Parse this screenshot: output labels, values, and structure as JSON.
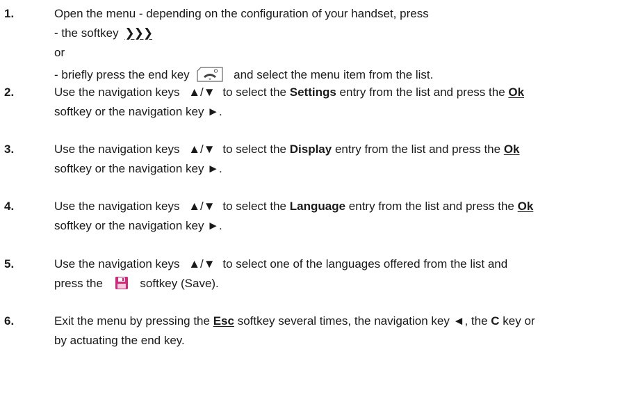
{
  "steps": [
    {
      "number": "1.",
      "line1": "Open the menu - depending on the configuration of your handset, press",
      "line2": "- the softkey",
      "softkey_symbol": "❯❯❯",
      "line3": "or",
      "line4_pre": "- briefly press the end key",
      "line4_post": "and select the menu item from the list.",
      "end_key_icon": "end-key-icon"
    },
    {
      "number": "2.",
      "pre": "Use the navigation keys",
      "nav_keys": "▲/▼",
      "mid": "to select the",
      "entry": "Settings",
      "post": "entry from the list and press the",
      "ok": "Ok",
      "line2": "softkey or the navigation key ►."
    },
    {
      "number": "3.",
      "pre": "Use the navigation keys",
      "nav_keys": "▲/▼",
      "mid": "to select the",
      "entry": "Display",
      "post": "entry from the list and press the",
      "ok": "Ok",
      "line2": "softkey or the navigation key ►."
    },
    {
      "number": "4.",
      "pre": "Use the navigation keys",
      "nav_keys": "▲/▼",
      "mid": "to select the",
      "entry": "Language",
      "post": "entry from the list and press the",
      "ok": "Ok",
      "line2": "softkey or the navigation key ►."
    },
    {
      "number": "5.",
      "pre": "Use the navigation keys",
      "nav_keys": "▲/▼",
      "post": "to select one of the languages offered from the list and",
      "line2_pre": "press the",
      "line2_post": "softkey (Save).",
      "save_icon": "save-icon",
      "save_color": "#d2287a"
    },
    {
      "number": "6.",
      "pre": "Exit the menu by pressing the",
      "esc": "Esc",
      "mid": "softkey several times, the navigation key ◄, the",
      "ckey": "C",
      "post": "key or",
      "line2": "by actuating the end key."
    }
  ]
}
